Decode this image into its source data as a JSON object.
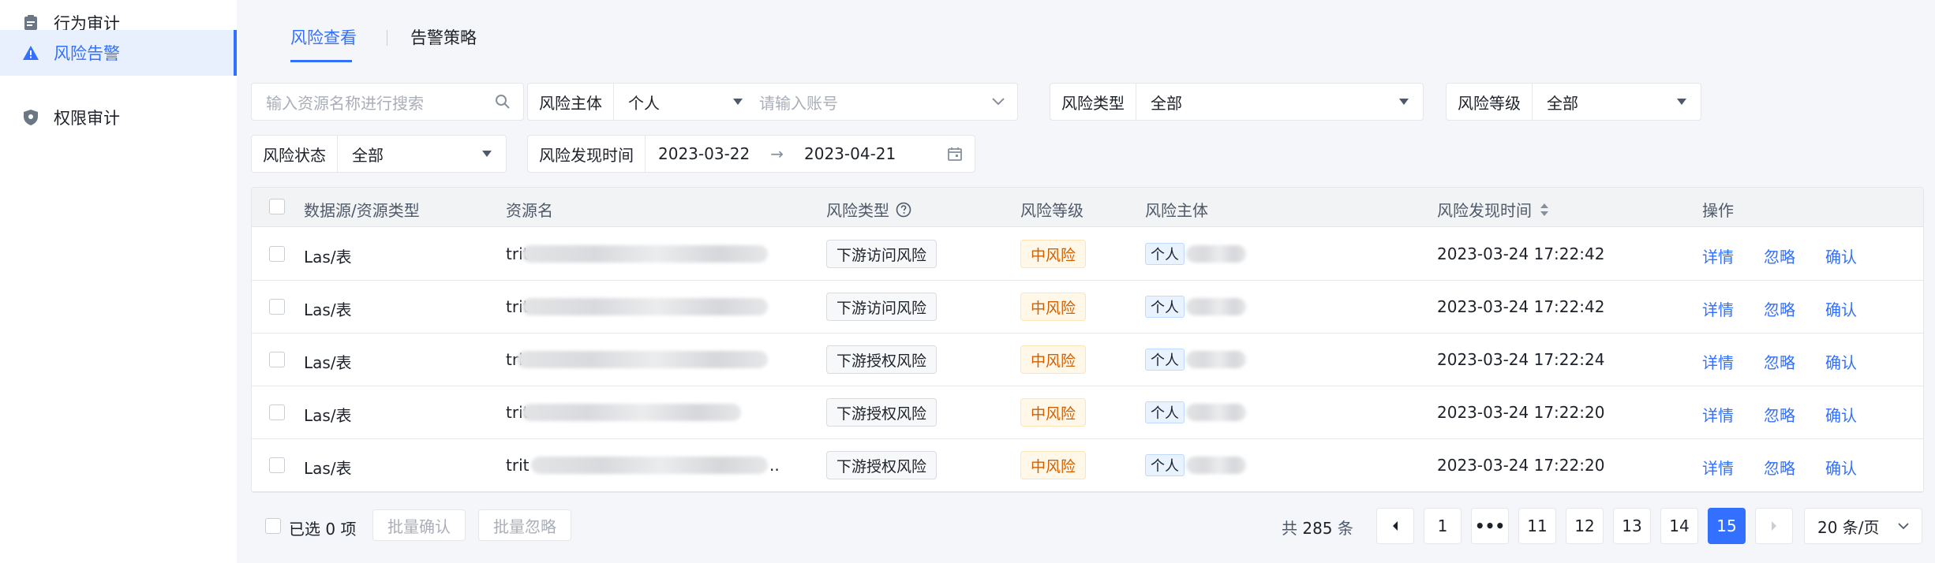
{
  "sidebar": {
    "items": [
      {
        "label": "行为审计",
        "icon": "clipboard-icon"
      },
      {
        "label": "风险告警",
        "icon": "warning-icon",
        "active": true
      },
      {
        "label": "权限审计",
        "icon": "shield-icon"
      }
    ]
  },
  "tabs": [
    {
      "label": "风险查看",
      "active": true
    },
    {
      "label": "告警策略"
    }
  ],
  "filters": {
    "search_placeholder": "输入资源名称进行搜索",
    "risk_subject_label": "风险主体",
    "risk_subject_value": "个人",
    "account_placeholder": "请输入账号",
    "risk_type_label": "风险类型",
    "risk_type_value": "全部",
    "risk_level_label": "风险等级",
    "risk_level_value": "全部",
    "risk_status_label": "风险状态",
    "risk_status_value": "全部",
    "discover_time_label": "风险发现时间",
    "date_start": "2023-03-22",
    "date_arrow": "→",
    "date_end": "2023-04-21"
  },
  "table": {
    "headers": {
      "source_type": "数据源/资源类型",
      "resource": "资源名",
      "risk_type": "风险类型",
      "risk_level": "风险等级",
      "subject": "风险主体",
      "time": "风险发现时间",
      "actions": "操作"
    },
    "rows": [
      {
        "source_type": "Las/表",
        "resource_prefix": "trit",
        "risk_type": "下游访问风险",
        "risk_level": "中风险",
        "subject_tag": "个人",
        "time": "2023-03-24 17:22:42"
      },
      {
        "source_type": "Las/表",
        "resource_prefix": "trit",
        "risk_type": "下游访问风险",
        "risk_level": "中风险",
        "subject_tag": "个人",
        "time": "2023-03-24 17:22:42"
      },
      {
        "source_type": "Las/表",
        "resource_prefix": "tri",
        "risk_type": "下游授权风险",
        "risk_level": "中风险",
        "subject_tag": "个人",
        "time": "2023-03-24 17:22:24"
      },
      {
        "source_type": "Las/表",
        "resource_prefix": "trit",
        "risk_type": "下游授权风险",
        "risk_level": "中风险",
        "subject_tag": "个人",
        "time": "2023-03-24 17:22:20"
      },
      {
        "source_type": "Las/表",
        "resource_prefix": "trit",
        "resource_suffix": "..",
        "risk_type": "下游授权风险",
        "risk_level": "中风险",
        "subject_tag": "个人",
        "time": "2023-03-24 17:22:20"
      }
    ],
    "actions": {
      "detail": "详情",
      "ignore": "忽略",
      "confirm": "确认"
    }
  },
  "footer": {
    "selected_prefix": "已选",
    "selected_count": "0",
    "selected_suffix": "项",
    "batch_confirm": "批量确认",
    "batch_ignore": "批量忽略",
    "total_prefix": "共",
    "total_count": "285",
    "total_suffix": "条",
    "pages": [
      "1",
      "•••",
      "11",
      "12",
      "13",
      "14",
      "15"
    ],
    "current_page": "15",
    "page_size": "20 条/页"
  },
  "colors": {
    "accent": "#3370ff",
    "warning_tag_text": "#d25f00",
    "warning_tag_bg": "#fff7e8"
  }
}
